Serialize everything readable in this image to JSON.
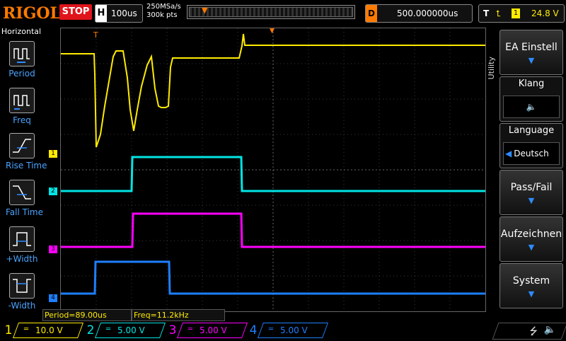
{
  "brand": "RIGOL",
  "run_state": "STOP",
  "timebase": {
    "label": "H",
    "value": "100us"
  },
  "sample": {
    "rate": "250MSa/s",
    "points": "300k pts"
  },
  "delay": {
    "label": "D",
    "value": "500.000000us"
  },
  "trigger": {
    "label": "T",
    "edge_icon": "rising-edge-icon",
    "source": "1",
    "level": "24.8 V"
  },
  "left_panel": {
    "title": "Horizontal",
    "items": [
      {
        "label": "Period",
        "icon": "period-measure-icon"
      },
      {
        "label": "Freq",
        "icon": "freq-measure-icon"
      },
      {
        "label": "Rise Time",
        "icon": "rise-time-icon"
      },
      {
        "label": "Fall Time",
        "icon": "fall-time-icon"
      },
      {
        "label": "+Width",
        "icon": "positive-width-icon"
      },
      {
        "label": "-Width",
        "icon": "negative-width-icon"
      }
    ]
  },
  "right_panel": {
    "vertical_label": "Utility",
    "ea_einstell": "EA Einstell",
    "klang": "Klang",
    "klang_icon": "speaker-icon",
    "language": "Language",
    "language_value": "Deutsch",
    "pass_fail": "Pass/Fail",
    "aufzeichnen": "Aufzeichnen",
    "system": "System"
  },
  "measurements": {
    "period": "Period=89.00us",
    "freq": "Freq=11.2kHz"
  },
  "channels": [
    {
      "num": "1",
      "scale": "10.0 V",
      "color": "#ffeb00",
      "marker": "1"
    },
    {
      "num": "2",
      "scale": "5.00 V",
      "color": "#00e5e5",
      "marker": "2"
    },
    {
      "num": "3",
      "scale": "5.00 V",
      "color": "#ff00ff",
      "marker": "3"
    },
    {
      "num": "4",
      "scale": "5.00 V",
      "color": "#1e7fff",
      "marker": "4"
    }
  ],
  "colors": {
    "accent": "#ff7a00",
    "stop": "#e0141b",
    "ch1": "#ffeb00",
    "ch2": "#00e5e5",
    "ch3": "#ff00ff",
    "ch4": "#1e7fff"
  }
}
